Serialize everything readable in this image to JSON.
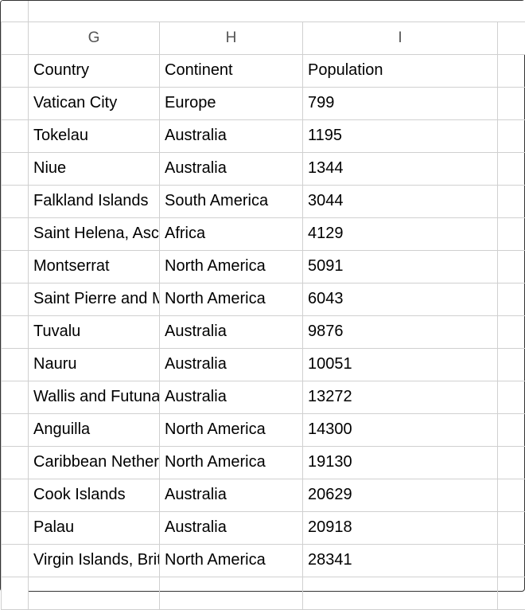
{
  "columns": {
    "G": "G",
    "H": "H",
    "I": "I"
  },
  "header": {
    "country": "Country",
    "continent": "Continent",
    "population": "Population"
  },
  "rows": [
    {
      "country": "Vatican City",
      "continent": "Europe",
      "population": "799"
    },
    {
      "country": "Tokelau",
      "continent": "Australia",
      "population": "1195"
    },
    {
      "country": "Niue",
      "continent": "Australia",
      "population": "1344"
    },
    {
      "country": "Falkland Islands",
      "continent": "South America",
      "population": "3044"
    },
    {
      "country": "Saint Helena, Ascension",
      "continent": "Africa",
      "population": "4129"
    },
    {
      "country": "Montserrat",
      "continent": "North America",
      "population": "5091"
    },
    {
      "country": "Saint Pierre and Miquelon",
      "continent": "North America",
      "population": "6043"
    },
    {
      "country": "Tuvalu",
      "continent": "Australia",
      "population": "9876"
    },
    {
      "country": "Nauru",
      "continent": "Australia",
      "population": "10051"
    },
    {
      "country": "Wallis and Futuna",
      "continent": "Australia",
      "population": "13272"
    },
    {
      "country": "Anguilla",
      "continent": "North America",
      "population": "14300"
    },
    {
      "country": "Caribbean Netherlands",
      "continent": "North America",
      "population": "19130"
    },
    {
      "country": "Cook Islands",
      "continent": "Australia",
      "population": "20629"
    },
    {
      "country": "Palau",
      "continent": "Australia",
      "population": "20918"
    },
    {
      "country": "Virgin Islands, British",
      "continent": "North America",
      "population": "28341"
    }
  ]
}
